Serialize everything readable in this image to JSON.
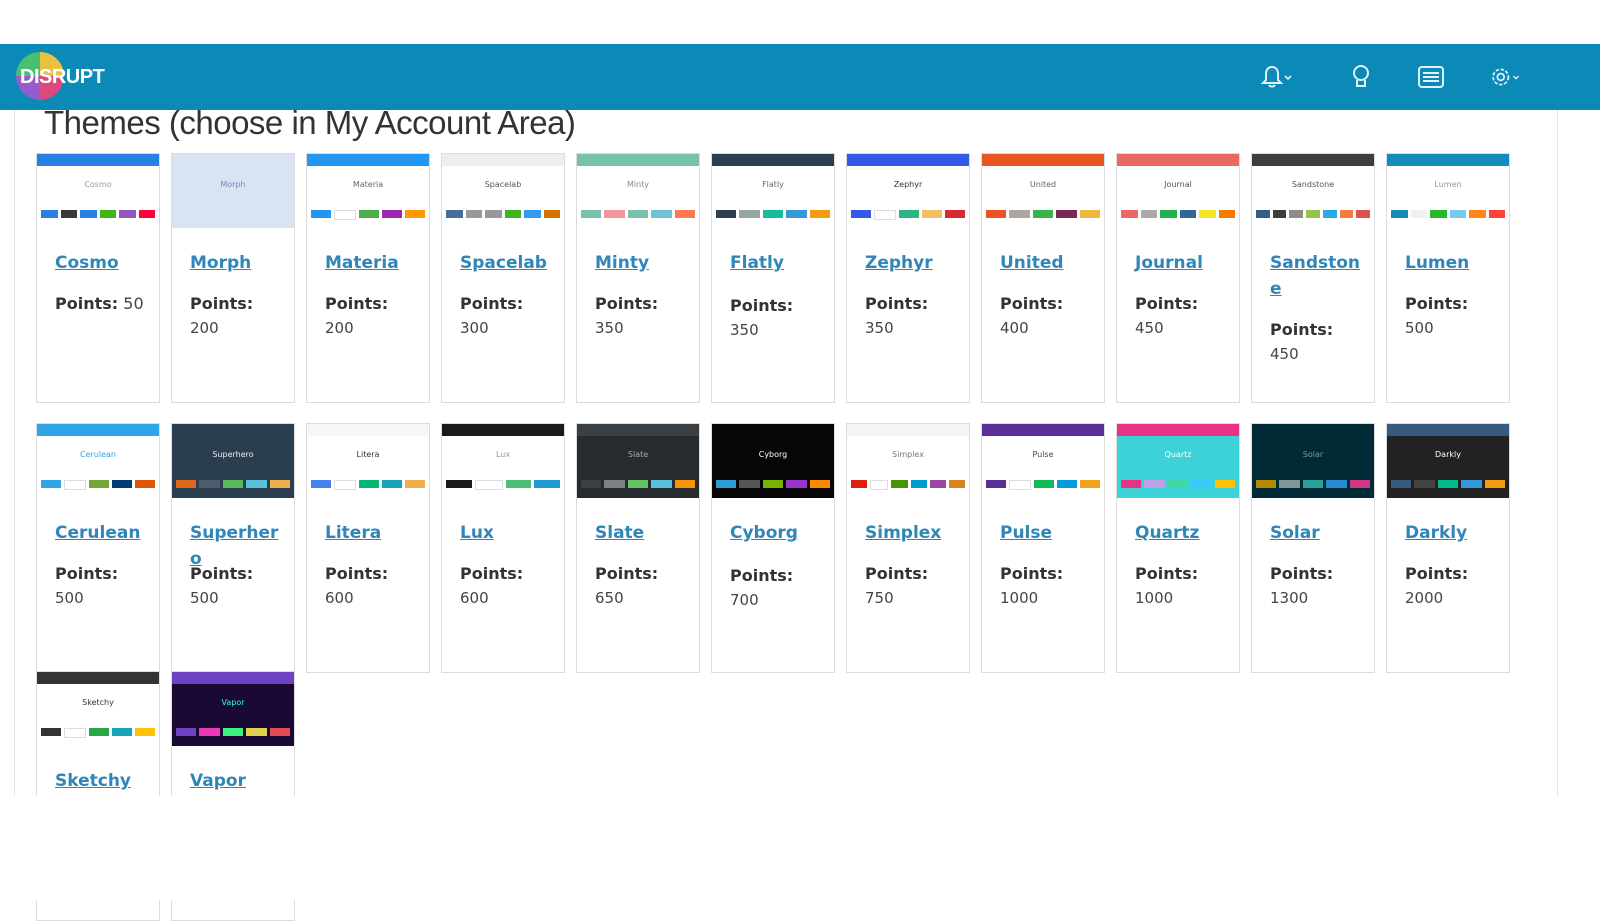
{
  "brand": {
    "name": "DISRUPT"
  },
  "header": {
    "icons": [
      "bell-icon",
      "lightbulb-icon",
      "list-icon",
      "gear-icon"
    ],
    "color": "#0b8ab8"
  },
  "page": {
    "title": "Themes (choose in My Account Area)"
  },
  "points_label": "Points:",
  "themes": [
    {
      "name": "Cosmo",
      "points": "50",
      "preview_title": "Cosmo",
      "nav": "#2780e3",
      "bg": "#ffffff",
      "text": "#999999",
      "btns": [
        "#2780e3",
        "#373a3c",
        "#2780e3",
        "#3fb618",
        "#9954bb",
        "#ff0039"
      ]
    },
    {
      "name": "Morph",
      "points": "200",
      "preview_title": "Morph",
      "nav": "#d9e3f1",
      "bg": "#d9e3f1",
      "text": "#7b8ab8",
      "btns": [
        "#d9e3f1",
        "#d9e3f1",
        "#d9e3f1",
        "#d9e3f1"
      ]
    },
    {
      "name": "Materia",
      "points": "200",
      "preview_title": "Materia",
      "nav": "#2196f3",
      "bg": "#ffffff",
      "text": "#666666",
      "btns": [
        "#2196f3",
        "#ffffff",
        "#4caf50",
        "#9c27b0",
        "#ff9800"
      ]
    },
    {
      "name": "Spacelab",
      "points": "300",
      "preview_title": "Spacelab",
      "nav": "#eeeeee",
      "bg": "#ffffff",
      "text": "#555555",
      "btns": [
        "#446e9b",
        "#999999",
        "#999999",
        "#3cb521",
        "#3399f3",
        "#d47500"
      ]
    },
    {
      "name": "Minty",
      "points": "350",
      "preview_title": "Minty",
      "nav": "#78c2ad",
      "bg": "#ffffff",
      "text": "#888888",
      "btns": [
        "#78c2ad",
        "#f3969a",
        "#78c2ad",
        "#6cc3d5",
        "#ff7851"
      ]
    },
    {
      "name": "Flatly",
      "points": "350",
      "preview_title": "Flatly",
      "nav": "#2c3e50",
      "bg": "#ffffff",
      "text": "#666666",
      "btns": [
        "#2c3e50",
        "#95a5a6",
        "#18bc9c",
        "#3498db",
        "#f39c12"
      ]
    },
    {
      "name": "Zephyr",
      "points": "350",
      "preview_title": "Zephyr",
      "nav": "#3459e6",
      "bg": "#ffffff",
      "text": "#333333",
      "btns": [
        "#3459e6",
        "#ffffff",
        "#2fb380",
        "#f4bd61",
        "#da292e"
      ]
    },
    {
      "name": "United",
      "points": "400",
      "preview_title": "United",
      "nav": "#e95420",
      "bg": "#ffffff",
      "text": "#666666",
      "btns": [
        "#e95420",
        "#aea79f",
        "#38b44a",
        "#772953",
        "#efb73e"
      ]
    },
    {
      "name": "Journal",
      "points": "450",
      "preview_title": "Journal",
      "nav": "#eb6864",
      "bg": "#ffffff",
      "text": "#555555",
      "btns": [
        "#eb6864",
        "#aaaaaa",
        "#22b24c",
        "#336699",
        "#f5e625",
        "#f57a00"
      ]
    },
    {
      "name": "Sandstone",
      "points": "450",
      "preview_title": "Sandstone",
      "nav": "#3e3f3a",
      "bg": "#ffffff",
      "text": "#555555",
      "btns": [
        "#325d88",
        "#3e3f3a",
        "#8e8c84",
        "#93c54b",
        "#29abe0",
        "#f47c3c",
        "#d9534f"
      ]
    },
    {
      "name": "Lumen",
      "points": "500",
      "preview_title": "Lumen",
      "nav": "#158cba",
      "bg": "#ffffff",
      "text": "#999999",
      "btns": [
        "#158cba",
        "#f0f0f0",
        "#28b62c",
        "#75caeb",
        "#ff851b",
        "#ff4136"
      ]
    },
    {
      "name": "Cerulean",
      "points": "500",
      "preview_title": "Cerulean",
      "nav": "#2fa4e7",
      "bg": "#ffffff",
      "text": "#2fa4e7",
      "btns": [
        "#2fa4e7",
        "#ffffff",
        "#73a839",
        "#033c73",
        "#dd5600"
      ]
    },
    {
      "name": "Superhero",
      "points": "500",
      "preview_title": "Superhero",
      "nav": "#2b3e50",
      "bg": "#2b3e50",
      "text": "#ebebeb",
      "btns": [
        "#df691a",
        "#4e5d6c",
        "#5cb85c",
        "#5bc0de",
        "#f0ad4e"
      ]
    },
    {
      "name": "Litera",
      "points": "600",
      "preview_title": "Litera",
      "nav": "#f7f7f9",
      "bg": "#ffffff",
      "text": "#333333",
      "btns": [
        "#4582ec",
        "#ffffff",
        "#02b875",
        "#17a2b8",
        "#f0ad4e"
      ]
    },
    {
      "name": "Lux",
      "points": "600",
      "preview_title": "Lux",
      "nav": "#1a1a1a",
      "bg": "#ffffff",
      "text": "#999999",
      "btns": [
        "#1a1a1a",
        "#ffffff",
        "#4bbf73",
        "#1f9bcf"
      ]
    },
    {
      "name": "Slate",
      "points": "650",
      "preview_title": "Slate",
      "nav": "#3a3f44",
      "bg": "#272b30",
      "text": "#aaaaaa",
      "btns": [
        "#3a3f44",
        "#7a8288",
        "#62c462",
        "#5bc0de",
        "#f89406"
      ]
    },
    {
      "name": "Cyborg",
      "points": "700",
      "preview_title": "Cyborg",
      "nav": "#060606",
      "bg": "#060606",
      "text": "#ffffff",
      "btns": [
        "#2a9fd6",
        "#555555",
        "#77b300",
        "#9933cc",
        "#ff8800"
      ]
    },
    {
      "name": "Simplex",
      "points": "750",
      "preview_title": "Simplex",
      "nav": "#f5f5f5",
      "bg": "#ffffff",
      "text": "#777777",
      "btns": [
        "#d9230f",
        "#ffffff",
        "#469408",
        "#029acf",
        "#9b479f",
        "#d9831f"
      ]
    },
    {
      "name": "Pulse",
      "points": "1000",
      "preview_title": "Pulse",
      "nav": "#593196",
      "bg": "#ffffff",
      "text": "#444444",
      "btns": [
        "#593196",
        "#ffffff",
        "#13b955",
        "#009cdc",
        "#efa31d"
      ]
    },
    {
      "name": "Quartz",
      "points": "1000",
      "preview_title": "Quartz",
      "nav": "#e83283",
      "bg": "#3cd2d8",
      "text": "#ffffff",
      "btns": [
        "#e83283",
        "#c0a0e8",
        "#41d7a7",
        "#39cbfb",
        "#ffc107"
      ]
    },
    {
      "name": "Solar",
      "points": "1300",
      "preview_title": "Solar",
      "nav": "#002b36",
      "bg": "#002b36",
      "text": "#839496",
      "btns": [
        "#b58900",
        "#839496",
        "#2aa198",
        "#268bd2",
        "#d33682"
      ]
    },
    {
      "name": "Darkly",
      "points": "2000",
      "preview_title": "Darkly",
      "nav": "#375a7f",
      "bg": "#222222",
      "text": "#ffffff",
      "btns": [
        "#375a7f",
        "#444444",
        "#00bc8c",
        "#3498db",
        "#f39c12"
      ]
    },
    {
      "name": "Sketchy",
      "points": "",
      "preview_title": "Sketchy",
      "nav": "#333333",
      "bg": "#ffffff",
      "text": "#333333",
      "btns": [
        "#333333",
        "#ffffff",
        "#28a745",
        "#17a2b8",
        "#ffc107"
      ]
    },
    {
      "name": "Vapor",
      "points": "",
      "preview_title": "Vapor",
      "nav": "#6f42c1",
      "bg": "#1a0933",
      "text": "#32fbe2",
      "btns": [
        "#6f42c1",
        "#ea39b8",
        "#3cf281",
        "#e1d04b",
        "#e44c55"
      ]
    }
  ]
}
